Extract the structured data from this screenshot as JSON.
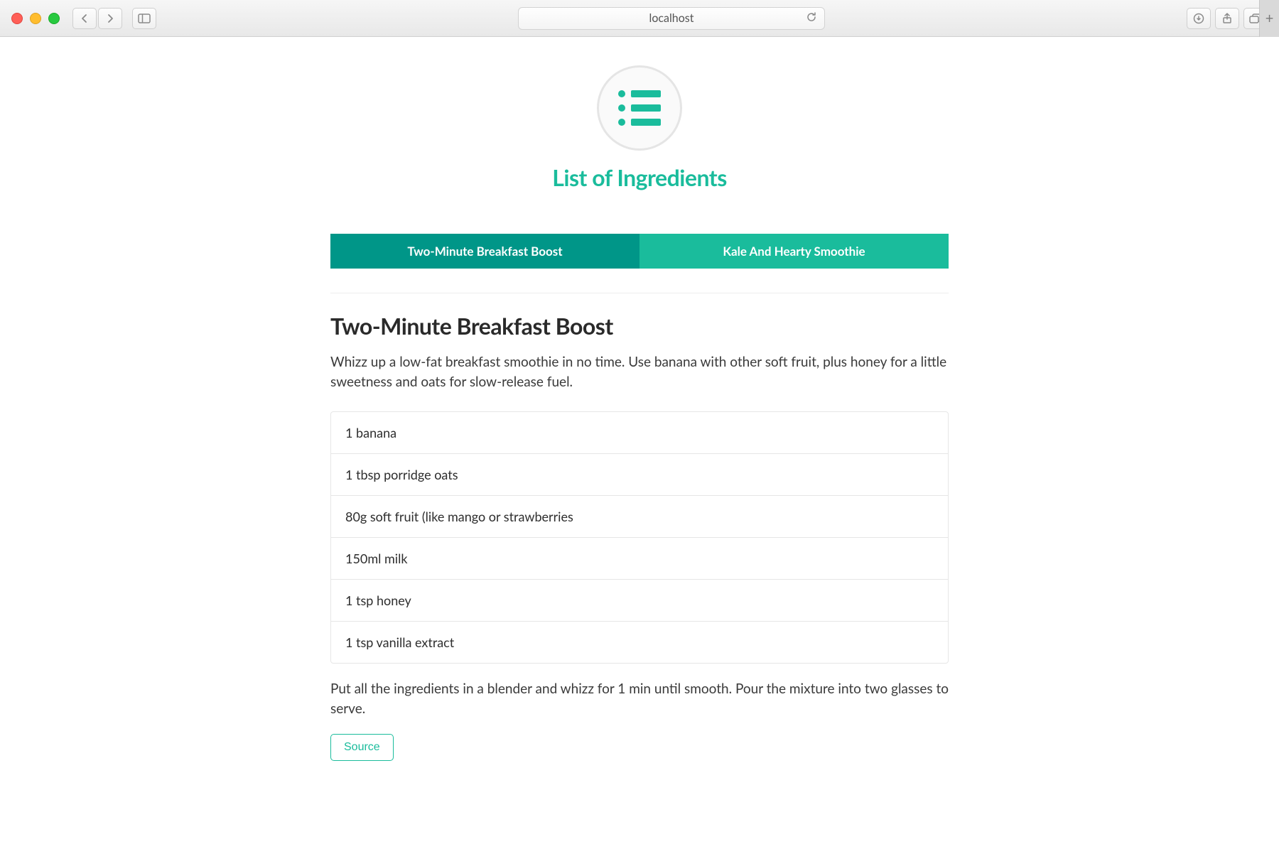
{
  "browser": {
    "url": "localhost"
  },
  "header": {
    "title": "List of Ingredients"
  },
  "tabs": [
    {
      "label": "Two-Minute Breakfast Boost",
      "active": true
    },
    {
      "label": "Kale And Hearty Smoothie",
      "active": false
    }
  ],
  "recipe": {
    "title": "Two-Minute Breakfast Boost",
    "description": "Whizz up a low-fat breakfast smoothie in no time. Use banana with other soft fruit, plus honey for a little sweetness and oats for slow-release fuel.",
    "ingredients": [
      "1 banana",
      "1 tbsp porridge oats",
      "80g soft fruit (like mango or strawberries",
      "150ml milk",
      "1 tsp honey",
      "1 tsp vanilla extract"
    ],
    "instructions": "Put all the ingredients in a blender and whizz for 1 min until smooth. Pour the mixture into two glasses to serve.",
    "source_label": "Source"
  }
}
